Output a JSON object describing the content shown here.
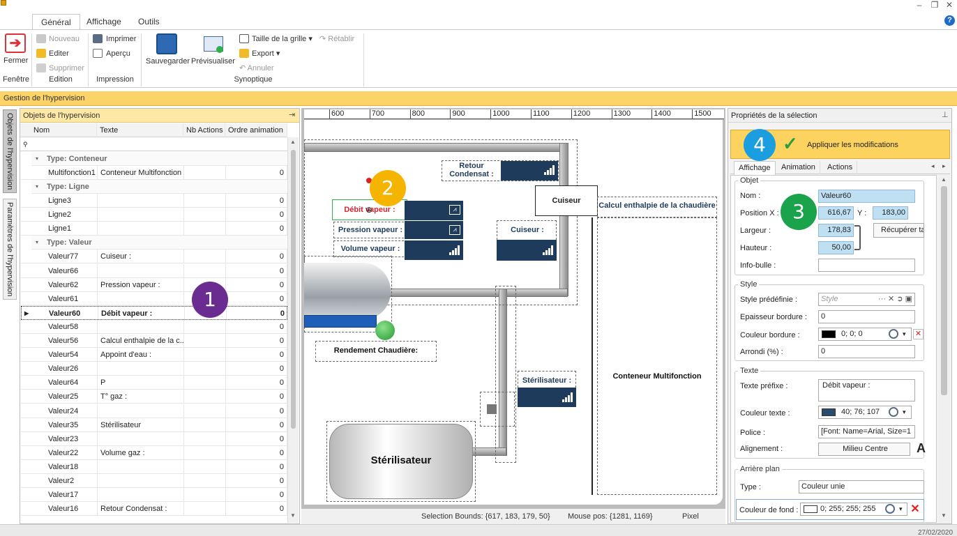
{
  "window": {
    "buttons": [
      "–",
      "❐",
      "✕"
    ],
    "help": "?"
  },
  "ribbon": {
    "tabs": [
      "Général",
      "Affichage",
      "Outils"
    ],
    "fermer": "Fermer",
    "nouveau": "Nouveau",
    "editer": "Editer",
    "supprimer": "Supprimer",
    "imprimer": "Imprimer",
    "apercu": "Aperçu",
    "sauvegarder": "Sauvegarder",
    "previsualiser": "Prévisualiser",
    "taille_grille": "Taille de la grille",
    "retablir": "Rétablir",
    "export": "Export",
    "annuler": "Annuler",
    "groups": [
      "Fenêtre",
      "Edition",
      "Impression",
      "Synoptique"
    ]
  },
  "banner": "Gestion de l'hypervision",
  "sidetabs": [
    "Objets de l'hypervision",
    "Paramètres de l'hypervision"
  ],
  "objects": {
    "title": "Objets de l'hypervision",
    "columns": [
      "Nom",
      "Texte",
      "Nb Actions",
      "Ordre animation"
    ],
    "groups": [
      {
        "title": "Type: Conteneur",
        "rows": [
          {
            "nom": "Multifonction1",
            "texte": "Conteneur Multifonction",
            "nb": "",
            "ordre": "0"
          }
        ]
      },
      {
        "title": "Type: Ligne",
        "rows": [
          {
            "nom": "Ligne3",
            "texte": "",
            "nb": "",
            "ordre": "0"
          },
          {
            "nom": "Ligne2",
            "texte": "",
            "nb": "",
            "ordre": "0"
          },
          {
            "nom": "Ligne1",
            "texte": "",
            "nb": "",
            "ordre": "0"
          }
        ]
      },
      {
        "title": "Type: Valeur",
        "rows": [
          {
            "nom": "Valeur77",
            "texte": "Cuiseur :",
            "nb": "",
            "ordre": "0"
          },
          {
            "nom": "Valeur66",
            "texte": "",
            "nb": "",
            "ordre": "0"
          },
          {
            "nom": "Valeur62",
            "texte": "Pression vapeur :",
            "nb": "",
            "ordre": "0"
          },
          {
            "nom": "Valeur61",
            "texte": "",
            "nb": "",
            "ordre": "0"
          },
          {
            "nom": "Valeur60",
            "texte": "Débit vapeur :",
            "nb": "",
            "ordre": "0",
            "selected": true
          },
          {
            "nom": "Valeur58",
            "texte": "",
            "nb": "",
            "ordre": "0"
          },
          {
            "nom": "Valeur56",
            "texte": "Calcul enthalpie de la c...",
            "nb": "",
            "ordre": "0"
          },
          {
            "nom": "Valeur54",
            "texte": "Appoint d'eau :",
            "nb": "",
            "ordre": "0"
          },
          {
            "nom": "Valeur26",
            "texte": "",
            "nb": "",
            "ordre": "0"
          },
          {
            "nom": "Valeur64",
            "texte": "P",
            "nb": "",
            "ordre": "0"
          },
          {
            "nom": "Valeur25",
            "texte": "T° gaz :",
            "nb": "",
            "ordre": "0"
          },
          {
            "nom": "Valeur24",
            "texte": "",
            "nb": "",
            "ordre": "0"
          },
          {
            "nom": "Valeur35",
            "texte": "Stérilisateur",
            "nb": "",
            "ordre": "0"
          },
          {
            "nom": "Valeur23",
            "texte": "",
            "nb": "",
            "ordre": "0"
          },
          {
            "nom": "Valeur22",
            "texte": "Volume gaz :",
            "nb": "",
            "ordre": "0"
          },
          {
            "nom": "Valeur18",
            "texte": "",
            "nb": "",
            "ordre": "0"
          },
          {
            "nom": "Valeur2",
            "texte": "",
            "nb": "",
            "ordre": "0"
          },
          {
            "nom": "Valeur17",
            "texte": "",
            "nb": "",
            "ordre": "0"
          },
          {
            "nom": "Valeur16",
            "texte": "Retour Condensat :",
            "nb": "",
            "ordre": "0"
          }
        ]
      }
    ]
  },
  "canvas": {
    "ruler": [
      "600",
      "700",
      "800",
      "900",
      "1000",
      "1100",
      "1200",
      "1300",
      "1400",
      "1500"
    ],
    "retour_condensat": "Retour\nCondensat :",
    "debit_vapeur": "Débit vapeur :",
    "pression_vapeur": "Pression vapeur :",
    "volume_vapeur": "Volume vapeur :",
    "cuiseur_label": "Cuiseur :",
    "cuiseur_box": "Cuiseur",
    "calcul": "Calcul enthalpie de la chaudière",
    "conteneur": "Conteneur Multifonction",
    "rendement": "Rendement Chaudière:",
    "sterilisateur_label": "Stérilisateur :",
    "sterilisateur_tank": "Stérilisateur"
  },
  "status": {
    "bounds": "Selection Bounds: {617, 183, 179, 50}",
    "mouse": "Mouse pos: {1281, 1169}",
    "unit": "Pixel",
    "date": "27/02/2020"
  },
  "props": {
    "title": "Propriétés de la sélection",
    "apply": "Appliquer les modifications",
    "tabs": [
      "Affichage",
      "Animation",
      "Actions"
    ],
    "objet": {
      "legend": "Objet",
      "nom_label": "Nom :",
      "nom": "Valeur60",
      "posx_label": "Position X :",
      "posx": "616,67",
      "y_label": "Y :",
      "y": "183,00",
      "largeur_label": "Largeur :",
      "largeur": "178,83",
      "hauteur_label": "Hauteur :",
      "hauteur": "50,00",
      "recuperer": "Récupérer ta",
      "infobulle_label": "Info-bulle :",
      "infobulle": ""
    },
    "style": {
      "legend": "Style",
      "predef_label": "Style prédéfinie :",
      "predef_placeholder": "Style",
      "epaisseur_label": "Epaisseur bordure :",
      "epaisseur": "0",
      "couleur_label": "Couleur bordure :",
      "couleur": "0; 0; 0",
      "couleur_hex": "#000000",
      "arrondi_label": "Arrondi (%) :",
      "arrondi": "0"
    },
    "texte": {
      "legend": "Texte",
      "prefixe_label": "Texte préfixe :",
      "prefixe": "Débit vapeur :",
      "couleur_label": "Couleur texte :",
      "couleur": "40; 76; 107",
      "couleur_hex": "#284c6b",
      "police_label": "Police :",
      "police": "[Font: Name=Arial, Size=1",
      "alignement_label": "Alignement :",
      "alignement": "Milieu Centre",
      "a": "A"
    },
    "arriere": {
      "legend": "Arrière plan",
      "type_label": "Type :",
      "type": "Couleur unie",
      "fond_label": "Couleur de fond :",
      "fond": "0; 255; 255; 255",
      "fond_hex": "#ffffff"
    }
  },
  "callouts": {
    "c1": "1",
    "c2": "2",
    "c3": "3",
    "c4": "4",
    "c1_color": "#6a2c91",
    "c2_color": "#f4b400",
    "c3_color": "#1aa34a",
    "c4_color": "#1a9ee0"
  }
}
